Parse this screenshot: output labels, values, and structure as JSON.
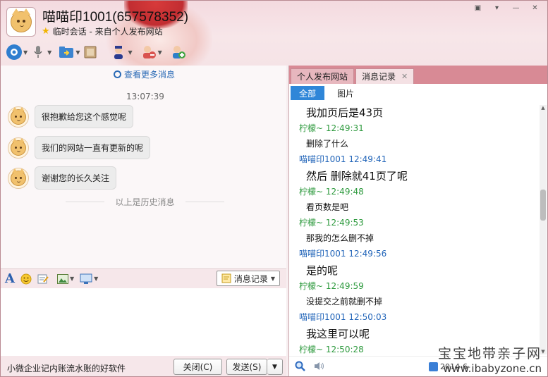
{
  "window": {
    "title": "喵喵印1001(657578352)",
    "subtitle": "临时会话 - 来自个人发布网站"
  },
  "window_controls": [
    "▣",
    "▾",
    "—",
    "✕"
  ],
  "chat": {
    "more_messages": "查看更多消息",
    "time": "13:07:39",
    "messages": [
      "很抱歉给您这个感觉呢",
      "我们的网站一直有更新的呢",
      "谢谢您的长久关注"
    ],
    "history_divider": "以上是历史消息"
  },
  "input_toolbar": {
    "font_icon": "A",
    "history_button": "消息记录"
  },
  "bottom": {
    "ad_text": "小微企业记内账流水账的好软件",
    "close_button": "关闭(C)",
    "send_button": "发送(S)"
  },
  "right_panel": {
    "tabs": [
      "个人发布网站",
      "消息记录"
    ],
    "subtabs": [
      "全部",
      "图片"
    ],
    "records": [
      {
        "type": "text",
        "size": "big",
        "text": "我加页后是43页"
      },
      {
        "type": "sender",
        "color": "green",
        "text": "柠檬~ 12:49:31"
      },
      {
        "type": "text",
        "size": "sm",
        "text": "删除了什么"
      },
      {
        "type": "sender",
        "color": "blue",
        "text": "喵喵印1001 12:49:41"
      },
      {
        "type": "text",
        "size": "big",
        "text": "然后 删除就41页了呢"
      },
      {
        "type": "sender",
        "color": "green",
        "text": "柠檬~ 12:49:48"
      },
      {
        "type": "text",
        "size": "sm",
        "text": "看页数是吧"
      },
      {
        "type": "sender",
        "color": "green",
        "text": "柠檬~ 12:49:53"
      },
      {
        "type": "text",
        "size": "sm",
        "text": "那我的怎么删不掉"
      },
      {
        "type": "sender",
        "color": "blue",
        "text": "喵喵印1001 12:49:56"
      },
      {
        "type": "text",
        "size": "big",
        "text": "是的呢"
      },
      {
        "type": "sender",
        "color": "green",
        "text": "柠檬~ 12:49:59"
      },
      {
        "type": "text",
        "size": "sm",
        "text": "没提交之前就删不掉"
      },
      {
        "type": "sender",
        "color": "blue",
        "text": "喵喵印1001 12:50:03"
      },
      {
        "type": "text",
        "size": "big",
        "text": "我这里可以呢"
      },
      {
        "type": "sender",
        "color": "green",
        "text": "柠檬~ 12:50:28"
      }
    ],
    "date": "2014-6-"
  },
  "watermark": {
    "line1": "宝宝地带亲子网",
    "line2": "www.ibabyzone.cn"
  },
  "colors": {
    "accent_blue": "#2f86d8",
    "sender_green": "#2e9a3e",
    "sender_blue": "#2265b9",
    "tab_bar": "#d88a95"
  }
}
